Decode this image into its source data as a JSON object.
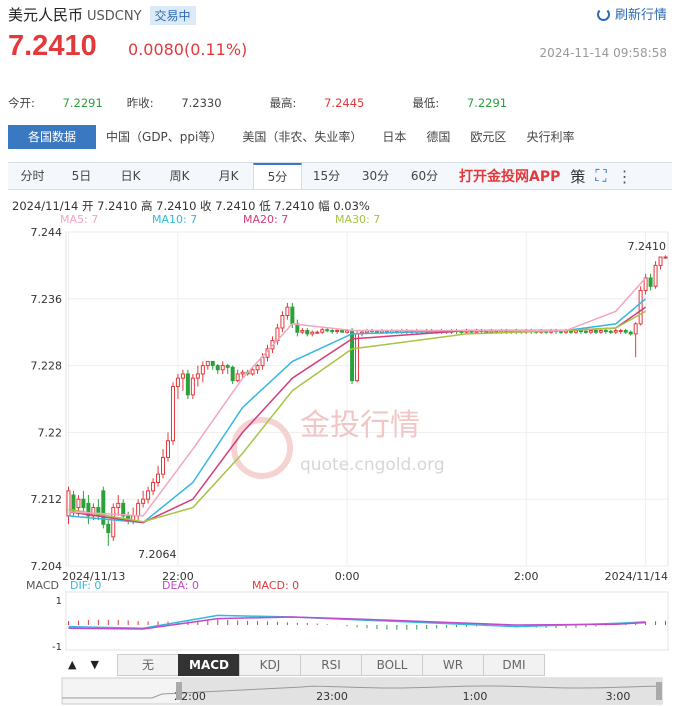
{
  "header": {
    "title": "美元人民币",
    "code": "USDCNY",
    "status": "交易中",
    "refresh_label": "刷新行情",
    "price": "7.2410",
    "change": "0.0080(0.11%)",
    "datetime": "2024-11-14 09:58:58"
  },
  "stats": {
    "open_label": "今开:",
    "open": "7.2291",
    "prev_label": "昨收:",
    "prev": "7.2330",
    "high_label": "最高:",
    "high": "7.2445",
    "low_label": "最低:",
    "low": "7.2291"
  },
  "data_tabs": [
    "各国数据",
    "中国（GDP、ppi等）",
    "美国（非农、失业率）",
    "日本",
    "德国",
    "欧元区",
    "央行利率"
  ],
  "period_tabs": [
    "分时",
    "5日",
    "日K",
    "周K",
    "月K",
    "5分",
    "15分",
    "30分",
    "60分"
  ],
  "app_label": "打开金投网APP",
  "tool_label": "策",
  "info_line": "2024/11/14  开 7.2410  高 7.2410  收 7.2410  低 7.2410  幅 0.03%",
  "ma_labels": {
    "ma5": "MA5: 7",
    "ma10": "MA10: 7",
    "ma20": "MA20: 7",
    "ma30": "MA30: 7"
  },
  "colors": {
    "up": "#e4393c",
    "down": "#2aa13a",
    "ma5": "#f2a6c0",
    "ma10": "#35b8e0",
    "ma20": "#d43b7a",
    "ma30": "#a7c444",
    "accent": "#3b78c2"
  },
  "macd_labels": {
    "name": "MACD",
    "dif": "DIF: 0",
    "dea": "DEA: 0",
    "macd": "MACD: 0"
  },
  "indicator_tabs": [
    "无",
    "MACD",
    "KDJ",
    "RSI",
    "BOLL",
    "WR",
    "DMI"
  ],
  "watermark": {
    "brand": "金投行情",
    "url": "quote.cngold.org"
  },
  "chart_data": {
    "type": "candlestick",
    "y_ticks": [
      "7.244",
      "7.236",
      "7.228",
      "7.22",
      "7.212",
      "7.204"
    ],
    "ylim": [
      7.204,
      7.244
    ],
    "x_ticks": [
      "2024/11/13",
      "22:00",
      "0:00",
      "2:00",
      "2024/11/14"
    ],
    "annotations": {
      "low_label": "7.2064",
      "last_label": "7.2410"
    },
    "macd_y_ticks": [
      "1",
      "-1"
    ],
    "navigator_ticks": [
      "22:00",
      "23:00",
      "1:00",
      "3:00"
    ],
    "candles": [
      [
        7.21,
        7.213,
        7.209,
        7.2135
      ],
      [
        7.2125,
        7.2105,
        7.21,
        7.213
      ],
      [
        7.211,
        7.212,
        7.21,
        7.2125
      ],
      [
        7.212,
        7.211,
        7.2105,
        7.213
      ],
      [
        7.2115,
        7.21,
        7.209,
        7.2125
      ],
      [
        7.21,
        7.211,
        7.2095,
        7.2115
      ],
      [
        7.211,
        7.21,
        7.2095,
        7.212
      ],
      [
        7.213,
        7.209,
        7.2085,
        7.2135
      ],
      [
        7.209,
        7.208,
        7.2064,
        7.2095
      ],
      [
        7.2075,
        7.211,
        7.207,
        7.2115
      ],
      [
        7.211,
        7.2115,
        7.21,
        7.2125
      ],
      [
        7.2115,
        7.21,
        7.2095,
        7.212
      ],
      [
        7.21,
        7.2095,
        7.209,
        7.2105
      ],
      [
        7.2095,
        7.21,
        7.209,
        7.211
      ],
      [
        7.21,
        7.2115,
        7.2095,
        7.212
      ],
      [
        7.2115,
        7.212,
        7.211,
        7.213
      ],
      [
        7.212,
        7.213,
        7.2115,
        7.2135
      ],
      [
        7.213,
        7.214,
        7.2125,
        7.2145
      ],
      [
        7.214,
        7.215,
        7.2135,
        7.216
      ],
      [
        7.215,
        7.217,
        7.2145,
        7.218
      ],
      [
        7.217,
        7.219,
        7.2165,
        7.22
      ],
      [
        7.219,
        7.2255,
        7.2185,
        7.226
      ],
      [
        7.2255,
        7.2265,
        7.224,
        7.227
      ],
      [
        7.2265,
        7.227,
        7.225,
        7.2275
      ],
      [
        7.227,
        7.2245,
        7.224,
        7.2275
      ],
      [
        7.2245,
        7.2265,
        7.224,
        7.227
      ],
      [
        7.2265,
        7.227,
        7.2255,
        7.228
      ],
      [
        7.227,
        7.228,
        7.226,
        7.2285
      ],
      [
        7.228,
        7.2285,
        7.2275,
        7.2285
      ],
      [
        7.2285,
        7.228,
        7.2275,
        7.2285
      ],
      [
        7.228,
        7.2275,
        7.227,
        7.2282
      ],
      [
        7.2275,
        7.228,
        7.227,
        7.2285
      ],
      [
        7.228,
        7.2278,
        7.227,
        7.2282
      ],
      [
        7.2278,
        7.2262,
        7.2258,
        7.228
      ],
      [
        7.2262,
        7.227,
        7.226,
        7.2275
      ],
      [
        7.227,
        7.2272,
        7.2265,
        7.2275
      ],
      [
        7.2272,
        7.227,
        7.2268,
        7.2275
      ],
      [
        7.227,
        7.2275,
        7.2268,
        7.2278
      ],
      [
        7.2275,
        7.228,
        7.227,
        7.2282
      ],
      [
        7.228,
        7.229,
        7.2275,
        7.2295
      ],
      [
        7.229,
        7.23,
        7.2285,
        7.2305
      ],
      [
        7.23,
        7.231,
        7.2295,
        7.2315
      ],
      [
        7.231,
        7.2325,
        7.2305,
        7.233
      ],
      [
        7.2325,
        7.234,
        7.232,
        7.2345
      ],
      [
        7.234,
        7.235,
        7.2335,
        7.2355
      ],
      [
        7.235,
        7.233,
        7.2325,
        7.2355
      ],
      [
        7.233,
        7.232,
        7.2315,
        7.2335
      ],
      [
        7.232,
        7.2322,
        7.2318,
        7.2325
      ],
      [
        7.2322,
        7.2318,
        7.2315,
        7.2325
      ],
      [
        7.2318,
        7.232,
        7.2315,
        7.2322
      ],
      [
        7.232,
        7.232,
        7.2318,
        7.2322
      ],
      [
        7.232,
        7.2323,
        7.2318,
        7.2325
      ],
      [
        7.2323,
        7.2322,
        7.232,
        7.2325
      ],
      [
        7.2322,
        7.2321,
        7.2318,
        7.2324
      ],
      [
        7.2321,
        7.2322,
        7.2318,
        7.2324
      ],
      [
        7.2322,
        7.232,
        7.232,
        7.2322
      ],
      [
        7.232,
        7.2322,
        7.2318,
        7.2324
      ],
      [
        7.2322,
        7.2262,
        7.2258,
        7.2325
      ],
      [
        7.2262,
        7.2318,
        7.226,
        7.2322
      ],
      [
        7.2318,
        7.232,
        7.2315,
        7.2322
      ],
      [
        7.232,
        7.2322,
        7.2318,
        7.2324
      ],
      [
        7.2322,
        7.2321,
        7.2318,
        7.2324
      ],
      [
        7.2321,
        7.232,
        7.2318,
        7.2323
      ],
      [
        7.232,
        7.2322,
        7.2318,
        7.2324
      ],
      [
        7.2322,
        7.232,
        7.2318,
        7.2323
      ],
      [
        7.232,
        7.2322,
        7.2318,
        7.2324
      ],
      [
        7.2322,
        7.232,
        7.2318,
        7.2323
      ],
      [
        7.232,
        7.2322,
        7.2318,
        7.2324
      ],
      [
        7.2322,
        7.2321,
        7.2318,
        7.2324
      ],
      [
        7.2321,
        7.232,
        7.2318,
        7.2323
      ],
      [
        7.232,
        7.2322,
        7.2318,
        7.2324
      ],
      [
        7.2322,
        7.232,
        7.2318,
        7.2323
      ],
      [
        7.232,
        7.2322,
        7.2318,
        7.2324
      ],
      [
        7.2322,
        7.2321,
        7.2318,
        7.2324
      ],
      [
        7.2321,
        7.232,
        7.2318,
        7.2323
      ],
      [
        7.232,
        7.2322,
        7.2318,
        7.2324
      ],
      [
        7.2322,
        7.232,
        7.2318,
        7.2323
      ],
      [
        7.232,
        7.2322,
        7.2318,
        7.2324
      ],
      [
        7.2322,
        7.2321,
        7.2318,
        7.2324
      ],
      [
        7.2321,
        7.232,
        7.2318,
        7.2323
      ],
      [
        7.232,
        7.2322,
        7.2318,
        7.2324
      ],
      [
        7.2322,
        7.232,
        7.2318,
        7.2323
      ],
      [
        7.232,
        7.2322,
        7.2318,
        7.2324
      ],
      [
        7.2322,
        7.2321,
        7.2318,
        7.2324
      ],
      [
        7.2321,
        7.232,
        7.2318,
        7.2323
      ],
      [
        7.232,
        7.2322,
        7.2318,
        7.2324
      ],
      [
        7.2322,
        7.232,
        7.2318,
        7.2323
      ],
      [
        7.232,
        7.2322,
        7.2318,
        7.2324
      ],
      [
        7.2322,
        7.2321,
        7.2318,
        7.2324
      ],
      [
        7.2321,
        7.232,
        7.2318,
        7.2323
      ],
      [
        7.232,
        7.2322,
        7.2318,
        7.2324
      ],
      [
        7.2322,
        7.232,
        7.2318,
        7.2323
      ],
      [
        7.232,
        7.2322,
        7.2318,
        7.2324
      ],
      [
        7.2322,
        7.2321,
        7.2318,
        7.2324
      ],
      [
        7.2321,
        7.232,
        7.2318,
        7.2323
      ],
      [
        7.232,
        7.2322,
        7.2318,
        7.2324
      ],
      [
        7.2322,
        7.232,
        7.2318,
        7.2323
      ],
      [
        7.232,
        7.2322,
        7.2318,
        7.2324
      ],
      [
        7.2322,
        7.2321,
        7.2318,
        7.2324
      ],
      [
        7.2321,
        7.232,
        7.2318,
        7.2323
      ],
      [
        7.232,
        7.2322,
        7.2318,
        7.2324
      ],
      [
        7.2322,
        7.232,
        7.2318,
        7.2323
      ],
      [
        7.232,
        7.2322,
        7.2318,
        7.2324
      ],
      [
        7.2322,
        7.2321,
        7.2318,
        7.2324
      ],
      [
        7.2321,
        7.232,
        7.2318,
        7.2323
      ],
      [
        7.232,
        7.2322,
        7.2318,
        7.2324
      ],
      [
        7.2322,
        7.232,
        7.2318,
        7.2323
      ],
      [
        7.232,
        7.2322,
        7.2318,
        7.2324
      ],
      [
        7.2322,
        7.2321,
        7.2318,
        7.2324
      ],
      [
        7.2321,
        7.232,
        7.2318,
        7.2323
      ],
      [
        7.232,
        7.2322,
        7.2318,
        7.2324
      ],
      [
        7.2322,
        7.2322,
        7.2318,
        7.2324
      ],
      [
        7.2322,
        7.232,
        7.2318,
        7.2324
      ],
      [
        7.232,
        7.2318,
        7.2316,
        7.2322
      ],
      [
        7.2318,
        7.233,
        7.229,
        7.2332
      ],
      [
        7.233,
        7.237,
        7.2328,
        7.2375
      ],
      [
        7.237,
        7.2385,
        7.2365,
        7.239
      ],
      [
        7.2385,
        7.2375,
        7.237,
        7.239
      ],
      [
        7.2375,
        7.24,
        7.2372,
        7.2405
      ],
      [
        7.24,
        7.241,
        7.2395,
        7.241
      ],
      [
        7.241,
        7.241,
        7.2408,
        7.2412
      ]
    ],
    "ma": {
      "ma10_points": [
        [
          0,
          7.21
        ],
        [
          15,
          7.2092
        ],
        [
          25,
          7.214
        ],
        [
          35,
          7.223
        ],
        [
          45,
          7.2285
        ],
        [
          57,
          7.2318
        ],
        [
          80,
          7.2322
        ],
        [
          100,
          7.2322
        ],
        [
          110,
          7.233
        ],
        [
          116,
          7.236
        ]
      ],
      "ma20_points": [
        [
          0,
          7.2105
        ],
        [
          15,
          7.2092
        ],
        [
          25,
          7.212
        ],
        [
          35,
          7.22
        ],
        [
          45,
          7.2265
        ],
        [
          57,
          7.2312
        ],
        [
          80,
          7.2322
        ],
        [
          100,
          7.2322
        ],
        [
          110,
          7.2325
        ],
        [
          116,
          7.235
        ]
      ],
      "ma30_points": [
        [
          0,
          7.2108
        ],
        [
          15,
          7.2093
        ],
        [
          25,
          7.211
        ],
        [
          35,
          7.2175
        ],
        [
          45,
          7.225
        ],
        [
          57,
          7.23
        ],
        [
          80,
          7.2318
        ],
        [
          100,
          7.2322
        ],
        [
          110,
          7.2325
        ],
        [
          116,
          7.2345
        ]
      ],
      "ma5_points": [
        [
          0,
          7.2105
        ],
        [
          15,
          7.21
        ],
        [
          25,
          7.218
        ],
        [
          35,
          7.2265
        ],
        [
          45,
          7.233
        ],
        [
          57,
          7.2322
        ],
        [
          80,
          7.2322
        ],
        [
          100,
          7.2322
        ],
        [
          110,
          7.2345
        ],
        [
          116,
          7.2385
        ]
      ]
    },
    "macd": {
      "dif": [
        [
          0,
          -0.1
        ],
        [
          15,
          -0.2
        ],
        [
          30,
          0.6
        ],
        [
          45,
          0.5
        ],
        [
          60,
          0.3
        ],
        [
          90,
          -0.1
        ],
        [
          110,
          0.1
        ],
        [
          116,
          0.2
        ]
      ],
      "dea": [
        [
          0,
          -0.2
        ],
        [
          15,
          -0.25
        ],
        [
          30,
          0.4
        ],
        [
          45,
          0.5
        ],
        [
          60,
          0.35
        ],
        [
          90,
          0.0
        ],
        [
          110,
          0.05
        ],
        [
          116,
          0.15
        ]
      ]
    }
  }
}
